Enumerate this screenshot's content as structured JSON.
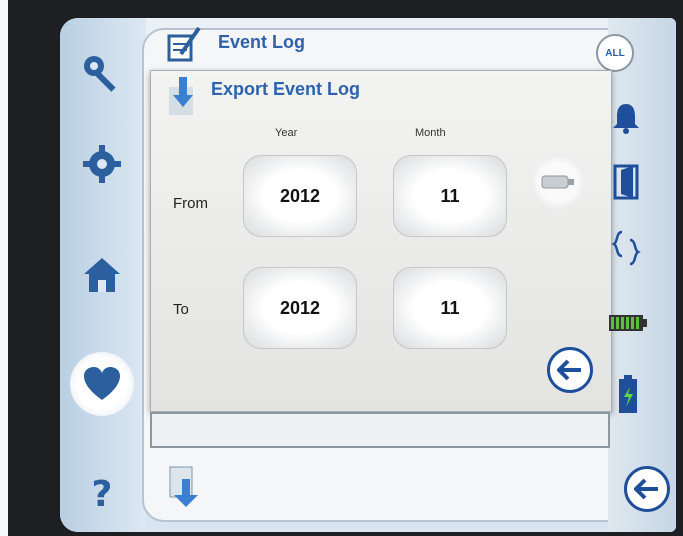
{
  "header": {
    "title": "Event Log"
  },
  "dialog": {
    "title": "Export Event Log",
    "col_year": "Year",
    "col_month": "Month",
    "row_from": "From",
    "row_to": "To",
    "from_year": "2012",
    "from_month": "11",
    "to_year": "2012",
    "to_month": "11"
  },
  "right_rail": {
    "all_label": "ALL"
  },
  "colors": {
    "accent_blue": "#2e62ad",
    "icon_blue": "#1f4e9b"
  },
  "icons": [
    "key-icon",
    "gear-icon",
    "home-icon",
    "heart-icon",
    "help-icon",
    "edit-log-icon",
    "export-icon",
    "bell-icon",
    "door-icon",
    "braces-icon",
    "battery-icon",
    "battery-charge-icon",
    "back-icon",
    "usb-icon"
  ]
}
